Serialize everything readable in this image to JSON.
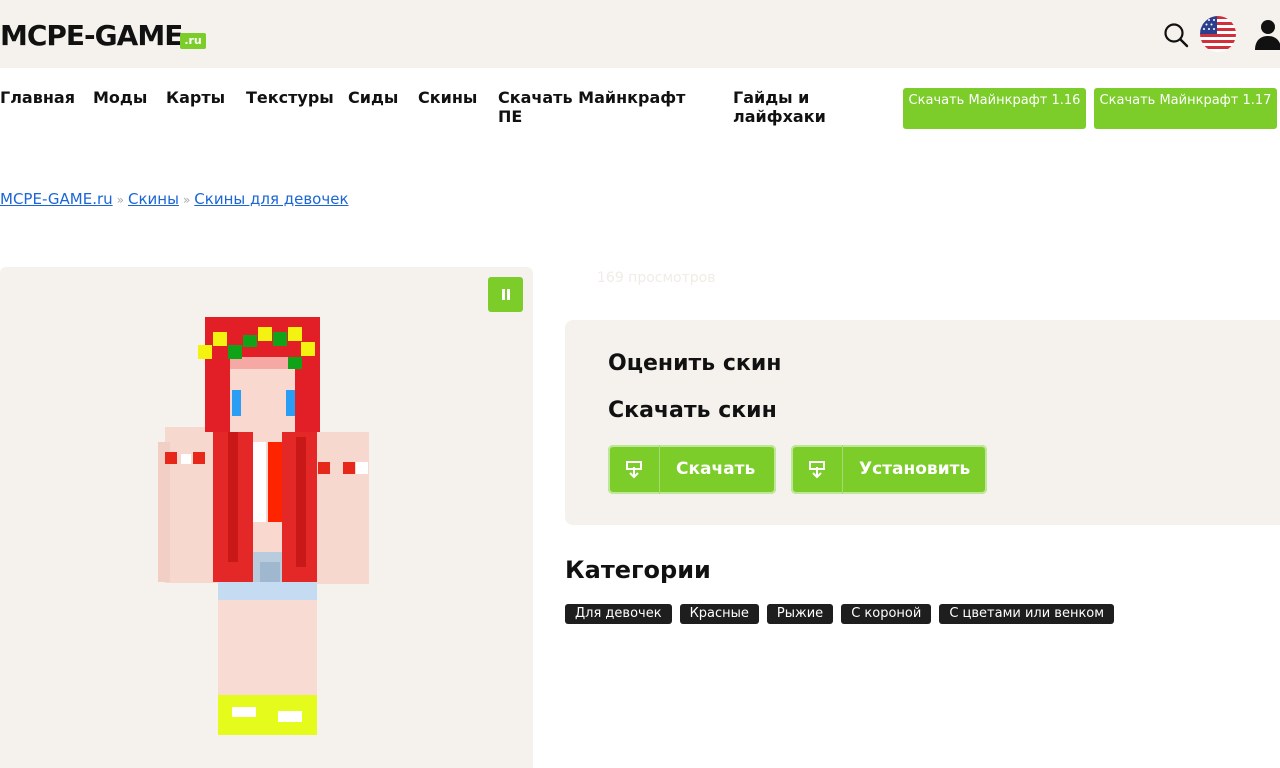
{
  "header": {
    "logo_main": "MCPE-GAME",
    "logo_tld": ".ru",
    "icons": {
      "search": "search-icon",
      "flag": "us-flag-icon",
      "user": "user-icon"
    }
  },
  "nav": {
    "items": [
      "Главная",
      "Моды",
      "Карты",
      "Текстуры",
      "Сиды",
      "Скины",
      "Скачать Майнкрафт ПЕ",
      "Гайды и лайфхаки"
    ],
    "buttons": [
      "Скачать Майнкрафт 1.16",
      "Скачать Майнкрафт 1.17"
    ]
  },
  "breadcrumb": {
    "items": [
      "MCPE-GAME.ru",
      "Скины",
      "Скины для девочек"
    ],
    "separator": "»"
  },
  "views": "169 просмотров",
  "card": {
    "rate_title": "Оценить скин",
    "download_title": "Скачать скин",
    "download_btn": "Скачать",
    "install_btn": "Установить"
  },
  "categories": {
    "title": "Категории",
    "tags": [
      "Для девочек",
      "Красные",
      "Рыжие",
      "С короной",
      "С цветами или венком"
    ]
  },
  "colors": {
    "accent": "#7ccd2a",
    "panel": "#f5f2ed",
    "link": "#1a66d6"
  }
}
